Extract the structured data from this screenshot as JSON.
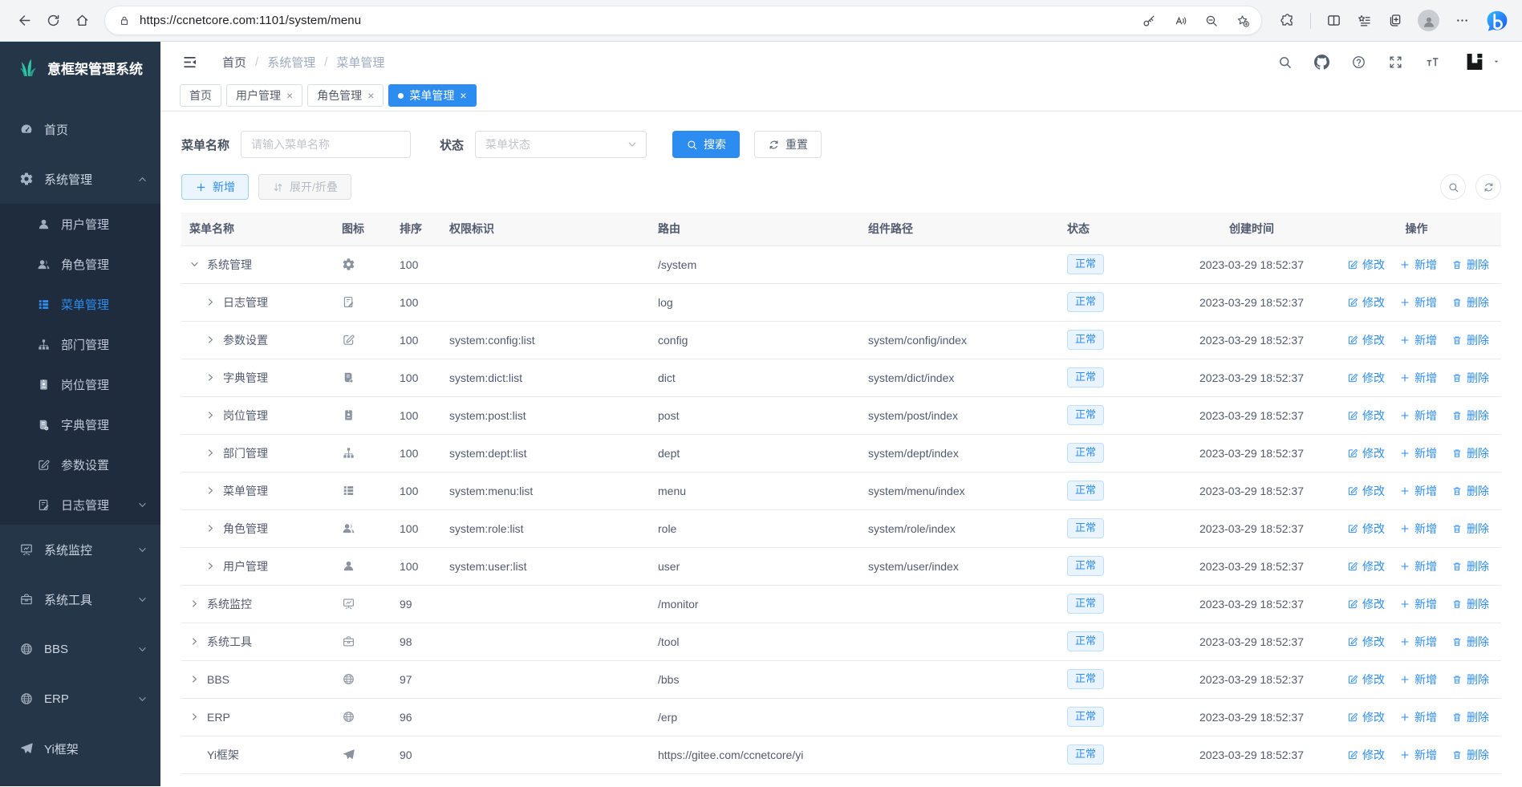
{
  "colors": {
    "primary": "#2d8cf0",
    "sidebar_bg": "#253649",
    "sidebar_submenu_bg": "#1e2c3e",
    "badge_bg": "#e9f4fe",
    "badge_text": "#2d8cf0"
  },
  "browser": {
    "url": "https://ccnetcore.com:1101/system/menu",
    "pill_icons": [
      "key-icon",
      "read-aloud-icon",
      "zoom-out-icon",
      "favorite-add-icon"
    ],
    "right_icons": [
      "extensions-icon",
      "split-screen-icon",
      "collections-icon",
      "tabs-icon",
      "profile-avatar",
      "more-icon",
      "bing-icon"
    ]
  },
  "sidebar": {
    "title": "意框架管理系统",
    "items": [
      {
        "key": "home",
        "label": "首页",
        "icon": "dashboard-icon"
      },
      {
        "key": "system",
        "label": "系统管理",
        "icon": "gear-icon",
        "expanded": true,
        "children": [
          {
            "key": "user",
            "label": "用户管理",
            "icon": "user-icon"
          },
          {
            "key": "role",
            "label": "角色管理",
            "icon": "users-icon"
          },
          {
            "key": "menu",
            "label": "菜单管理",
            "icon": "menu-list-icon",
            "active": true
          },
          {
            "key": "dept",
            "label": "部门管理",
            "icon": "org-tree-icon"
          },
          {
            "key": "post",
            "label": "岗位管理",
            "icon": "badge-icon"
          },
          {
            "key": "dict",
            "label": "字典管理",
            "icon": "book-icon"
          },
          {
            "key": "config",
            "label": "参数设置",
            "icon": "edit-square-icon"
          },
          {
            "key": "log",
            "label": "日志管理",
            "icon": "log-icon",
            "chevron": true
          }
        ]
      },
      {
        "key": "monitor",
        "label": "系统监控",
        "icon": "monitor-icon",
        "chevron": true
      },
      {
        "key": "tool",
        "label": "系统工具",
        "icon": "toolbox-icon",
        "chevron": true
      },
      {
        "key": "bbs",
        "label": "BBS",
        "icon": "globe-icon",
        "chevron": true
      },
      {
        "key": "erp",
        "label": "ERP",
        "icon": "globe-icon",
        "chevron": true
      },
      {
        "key": "yi",
        "label": "Yi框架",
        "icon": "send-icon"
      }
    ]
  },
  "header": {
    "breadcrumb": [
      "首页",
      "系统管理",
      "菜单管理"
    ],
    "right_icons": [
      "search-icon",
      "github-icon",
      "help-icon",
      "fullscreen-icon",
      "font-size-icon"
    ]
  },
  "tabs": [
    {
      "label": "首页",
      "closable": false,
      "active": false
    },
    {
      "label": "用户管理",
      "closable": true,
      "active": false
    },
    {
      "label": "角色管理",
      "closable": true,
      "active": false
    },
    {
      "label": "菜单管理",
      "closable": true,
      "active": true
    }
  ],
  "filters": {
    "name_label": "菜单名称",
    "name_placeholder": "请输入菜单名称",
    "status_label": "状态",
    "status_placeholder": "菜单状态",
    "search_label": "搜索",
    "reset_label": "重置"
  },
  "toolbar": {
    "add_label": "新增",
    "expand_label": "展开/折叠"
  },
  "table": {
    "columns": [
      "菜单名称",
      "图标",
      "排序",
      "权限标识",
      "路由",
      "组件路径",
      "状态",
      "创建时间",
      "操作"
    ],
    "actions": {
      "edit": "修改",
      "add": "新增",
      "delete": "删除"
    },
    "rows": [
      {
        "name": "系统管理",
        "level": 0,
        "expand": "down",
        "icon": "gear-icon",
        "order": "100",
        "perm": "",
        "route": "/system",
        "component": "",
        "status": "正常",
        "created": "2023-03-29 18:52:37"
      },
      {
        "name": "日志管理",
        "level": 1,
        "expand": "right",
        "icon": "log-icon",
        "order": "100",
        "perm": "",
        "route": "log",
        "component": "",
        "status": "正常",
        "created": "2023-03-29 18:52:37"
      },
      {
        "name": "参数设置",
        "level": 1,
        "expand": "right",
        "icon": "edit-square-icon",
        "order": "100",
        "perm": "system:config:list",
        "route": "config",
        "component": "system/config/index",
        "status": "正常",
        "created": "2023-03-29 18:52:37"
      },
      {
        "name": "字典管理",
        "level": 1,
        "expand": "right",
        "icon": "book-icon",
        "order": "100",
        "perm": "system:dict:list",
        "route": "dict",
        "component": "system/dict/index",
        "status": "正常",
        "created": "2023-03-29 18:52:37"
      },
      {
        "name": "岗位管理",
        "level": 1,
        "expand": "right",
        "icon": "badge-icon",
        "order": "100",
        "perm": "system:post:list",
        "route": "post",
        "component": "system/post/index",
        "status": "正常",
        "created": "2023-03-29 18:52:37"
      },
      {
        "name": "部门管理",
        "level": 1,
        "expand": "right",
        "icon": "org-tree-icon",
        "order": "100",
        "perm": "system:dept:list",
        "route": "dept",
        "component": "system/dept/index",
        "status": "正常",
        "created": "2023-03-29 18:52:37"
      },
      {
        "name": "菜单管理",
        "level": 1,
        "expand": "right",
        "icon": "menu-list-icon",
        "order": "100",
        "perm": "system:menu:list",
        "route": "menu",
        "component": "system/menu/index",
        "status": "正常",
        "created": "2023-03-29 18:52:37"
      },
      {
        "name": "角色管理",
        "level": 1,
        "expand": "right",
        "icon": "users-icon",
        "order": "100",
        "perm": "system:role:list",
        "route": "role",
        "component": "system/role/index",
        "status": "正常",
        "created": "2023-03-29 18:52:37"
      },
      {
        "name": "用户管理",
        "level": 1,
        "expand": "right",
        "icon": "user-icon",
        "order": "100",
        "perm": "system:user:list",
        "route": "user",
        "component": "system/user/index",
        "status": "正常",
        "created": "2023-03-29 18:52:37"
      },
      {
        "name": "系统监控",
        "level": 0,
        "expand": "right",
        "icon": "monitor-icon",
        "order": "99",
        "perm": "",
        "route": "/monitor",
        "component": "",
        "status": "正常",
        "created": "2023-03-29 18:52:37"
      },
      {
        "name": "系统工具",
        "level": 0,
        "expand": "right",
        "icon": "toolbox-icon",
        "order": "98",
        "perm": "",
        "route": "/tool",
        "component": "",
        "status": "正常",
        "created": "2023-03-29 18:52:37"
      },
      {
        "name": "BBS",
        "level": 0,
        "expand": "right",
        "icon": "globe-icon",
        "order": "97",
        "perm": "",
        "route": "/bbs",
        "component": "",
        "status": "正常",
        "created": "2023-03-29 18:52:37"
      },
      {
        "name": "ERP",
        "level": 0,
        "expand": "right",
        "icon": "globe-icon",
        "order": "96",
        "perm": "",
        "route": "/erp",
        "component": "",
        "status": "正常",
        "created": "2023-03-29 18:52:37"
      },
      {
        "name": "Yi框架",
        "level": 0,
        "expand": null,
        "icon": "send-icon",
        "order": "90",
        "perm": "",
        "route": "https://gitee.com/ccnetcore/yi",
        "component": "",
        "status": "正常",
        "created": "2023-03-29 18:52:37"
      }
    ]
  }
}
